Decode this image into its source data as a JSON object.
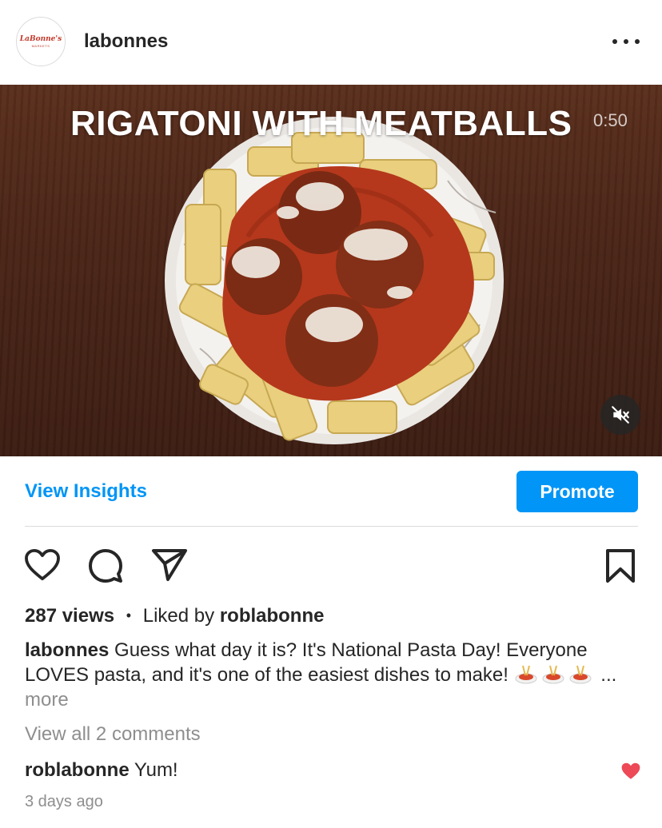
{
  "header": {
    "avatar_brand": "LaBonne's",
    "avatar_brand_sub": "MARKETS",
    "username": "labonnes"
  },
  "media": {
    "video_title": "RIGATONI WITH MEATBALLS",
    "video_time": "0:50",
    "muted": true
  },
  "insights": {
    "view_insights_label": "View Insights",
    "promote_label": "Promote"
  },
  "stats": {
    "views": "287 views",
    "separator": "•",
    "liked_by_prefix": "Liked by",
    "liked_by_user": "roblabonne"
  },
  "caption": {
    "username": "labonnes",
    "text": "Guess what day it is? It's National Pasta Day! Everyone LOVES pasta, and it's one of the easiest dishes to make!",
    "emoji_count": 3,
    "ellipsis": "...",
    "more_label": "more"
  },
  "comments": {
    "view_all_label": "View all 2 comments",
    "items": [
      {
        "username": "roblabonne",
        "text": "Yum!",
        "liked": true
      }
    ]
  },
  "timestamp": "3 days ago",
  "colors": {
    "accent": "#0095f6",
    "text": "#262626",
    "muted": "#8e8e8e",
    "heart": "#ed4956"
  },
  "icons": [
    "more-icon",
    "mute-icon",
    "heart-icon",
    "comment-icon",
    "share-icon",
    "bookmark-icon",
    "spaghetti-emoji"
  ]
}
